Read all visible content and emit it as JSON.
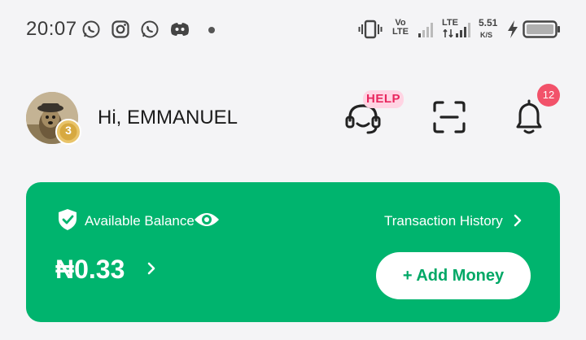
{
  "status_bar": {
    "time": "20:07",
    "notification_icons": [
      "whatsapp-icon",
      "instagram-icon",
      "whatsapp-icon",
      "discord-icon"
    ],
    "volte_label": "Vo\nLTE",
    "lte_label": "LTE",
    "speed_value": "5.51",
    "speed_unit": "K/S"
  },
  "header": {
    "avatar_level": "3",
    "greeting": "Hi, EMMANUEL",
    "help_label": "HELP",
    "notification_count": "12"
  },
  "balance_card": {
    "label": "Available Balance",
    "history_link": "Transaction History",
    "amount": "₦0.33",
    "add_money_label": "+ Add Money"
  },
  "colors": {
    "card": "#00b46e",
    "help_tag_bg": "#ffd4e3",
    "help_tag_text": "#e8265e",
    "badge": "#f2526a"
  }
}
